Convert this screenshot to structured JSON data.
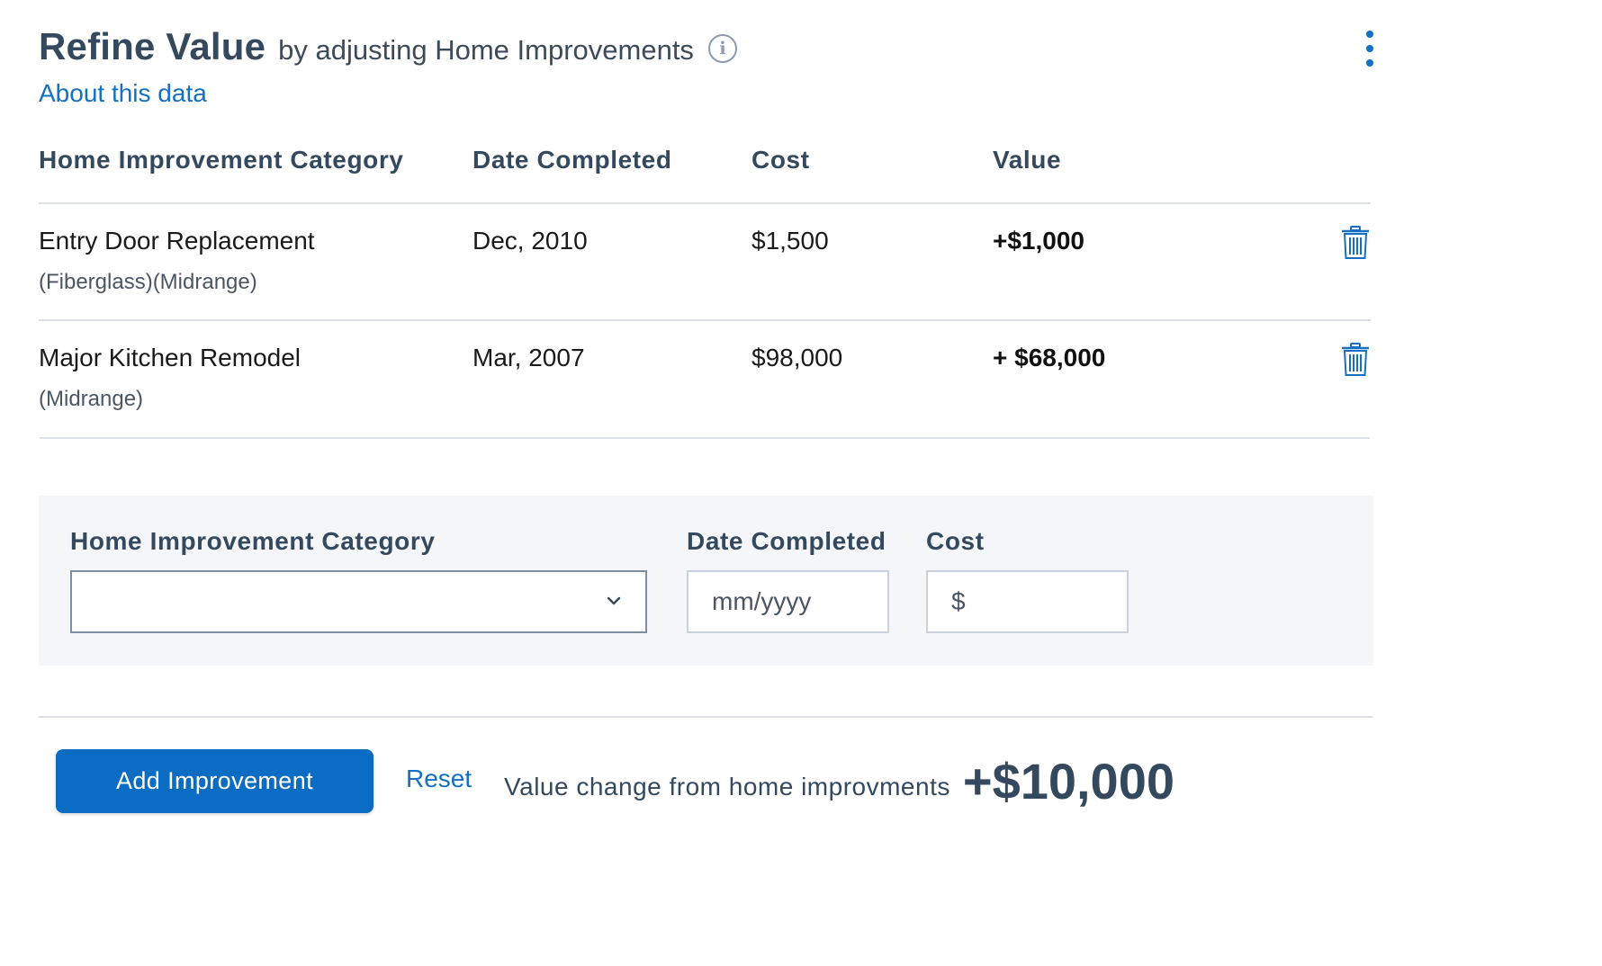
{
  "header": {
    "title": "Refine Value",
    "subtitle": "by adjusting Home Improvements",
    "info_icon": "info-circle-icon",
    "menu_icon": "kebab-menu-icon",
    "about_link": "About this data"
  },
  "table": {
    "columns": [
      "Home Improvement Category",
      "Date Completed",
      "Cost",
      "Value"
    ],
    "rows": [
      {
        "category": "Entry Door Replacement",
        "detail": "(Fiberglass)(Midrange)",
        "date": "Dec, 2010",
        "cost": "$1,500",
        "value": "+$1,000",
        "action_icon": "trash-icon"
      },
      {
        "category": "Major Kitchen Remodel",
        "detail": "(Midrange)",
        "date": "Mar, 2007",
        "cost": "$98,000",
        "value": "+ $68,000",
        "action_icon": "trash-icon"
      }
    ]
  },
  "form": {
    "category_label": "Home Improvement Category",
    "category_value": "",
    "date_label": "Date Completed",
    "date_placeholder": "mm/yyyy",
    "cost_label": "Cost",
    "cost_prefix": "$",
    "cost_value": ""
  },
  "footer": {
    "add_button": "Add Improvement",
    "reset_link": "Reset",
    "value_change_label": "Value change from home improvments",
    "value_change_amount": "+$10,000"
  },
  "colors": {
    "accent": "#1470c2",
    "button": "#0a6cc2",
    "heading": "#34495e",
    "panel_bg": "#f4f6f9"
  }
}
